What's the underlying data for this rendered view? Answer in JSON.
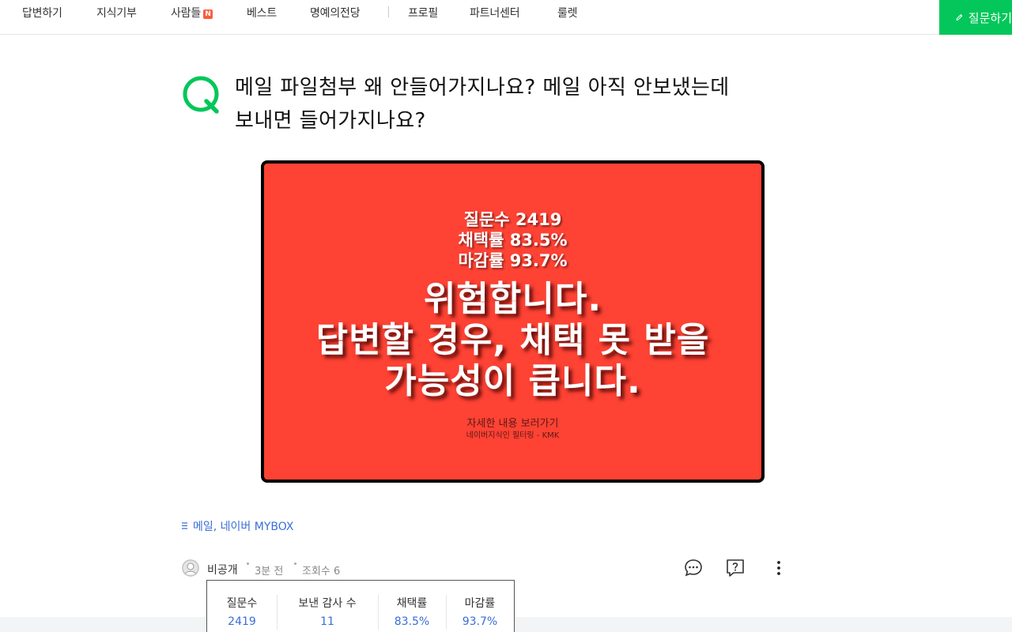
{
  "nav": {
    "items": [
      {
        "label": "답변하기"
      },
      {
        "label": "지식기부"
      },
      {
        "label": "사람들",
        "badge": "N"
      },
      {
        "label": "베스트"
      },
      {
        "label": "명예의전당"
      },
      {
        "label": "프로필"
      },
      {
        "label": "파트너센터"
      },
      {
        "label": "룰렛"
      }
    ],
    "ask_button": "질문하기"
  },
  "question": {
    "title_line1": "메일 파일첨부 왜 안들어가지나요? 메일 아직 안보냈는데",
    "title_line2": "보내면 들어가지나요?"
  },
  "banner": {
    "stats": [
      "질문수 2419",
      "채택률 83.5%",
      "마감률 93.7%"
    ],
    "warning": [
      "위험합니다.",
      "답변할 경우, 채택 못 받을",
      "가능성이 큽니다."
    ],
    "detail_link": "자세한 내용 보러가기",
    "credit": "네이버지식인 필터링 - KMK",
    "colors": {
      "background": "#fe4234",
      "border": "#000000"
    }
  },
  "tags": "메일, 네이버 MYBOX",
  "meta": {
    "author": "비공개",
    "time": "3분 전",
    "views": "조회수 6"
  },
  "stats_box": [
    {
      "label": "질문수",
      "value": "2419"
    },
    {
      "label": "보낸 감사 수",
      "value": "11"
    },
    {
      "label": "채택률",
      "value": "83.5%"
    },
    {
      "label": "마감률",
      "value": "93.7%"
    }
  ],
  "icons": [
    "pencil-icon",
    "q-logo-icon",
    "comment-icon",
    "question-report-icon",
    "more-vertical-icon",
    "tag-list-icon",
    "avatar-icon"
  ],
  "colors": {
    "brand_green": "#03c75a",
    "link_blue": "#3a6ed8"
  }
}
